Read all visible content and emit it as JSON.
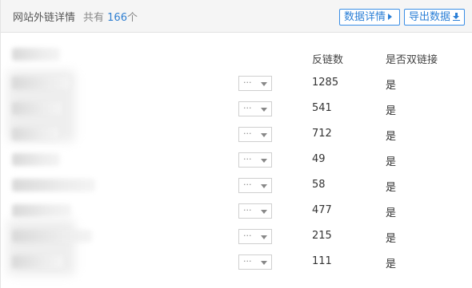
{
  "header": {
    "title": "网站外链详情",
    "count_prefix": "共有",
    "count": "166",
    "count_suffix": "个",
    "detail_button": "数据详情",
    "export_button": "导出数据"
  },
  "columns": {
    "backlinks": "反链数",
    "mutual": "是否双链接"
  },
  "rows": [
    {
      "select": "···",
      "backlinks": "1285",
      "mutual": "是"
    },
    {
      "select": "···",
      "backlinks": "541",
      "mutual": "是"
    },
    {
      "select": "···",
      "backlinks": "712",
      "mutual": "是"
    },
    {
      "select": "···",
      "backlinks": "49",
      "mutual": "是"
    },
    {
      "select": "···",
      "backlinks": "58",
      "mutual": "是"
    },
    {
      "select": "···",
      "backlinks": "477",
      "mutual": "是"
    },
    {
      "select": "···",
      "backlinks": "215",
      "mutual": "是"
    },
    {
      "select": "···",
      "backlinks": "111",
      "mutual": "是"
    }
  ],
  "colors": {
    "accent": "#2b7fd6",
    "header_bg": "#f5f5f5",
    "text": "#333333"
  },
  "icons": {
    "detail": "triangle-right-icon",
    "export": "download-icon",
    "select": "caret-down-icon"
  }
}
